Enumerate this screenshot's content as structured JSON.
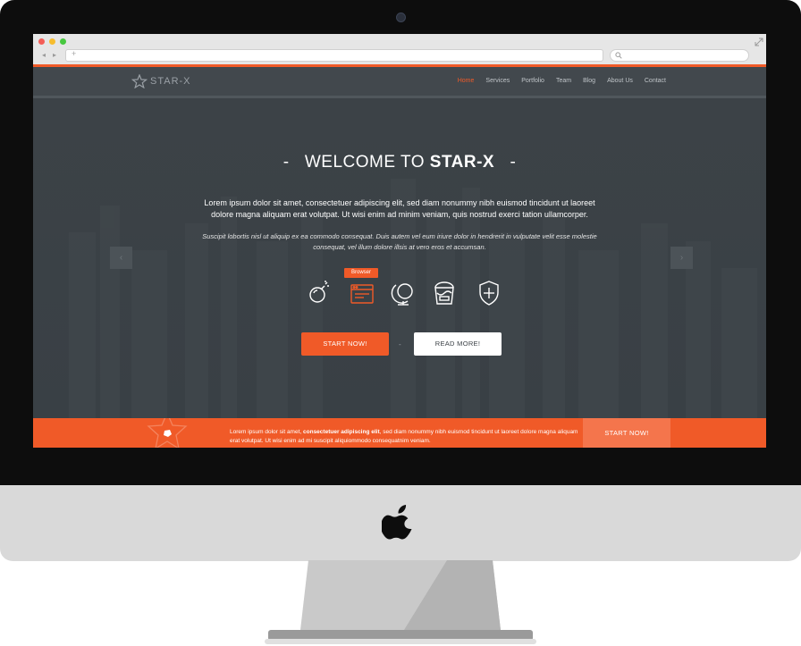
{
  "browser": {
    "url_text": "",
    "search_text": "",
    "back_glyph": "◂",
    "forward_glyph": "▸",
    "new_tab_glyph": "+"
  },
  "header": {
    "logo_text": "STAR-X",
    "nav": [
      "Home",
      "Services",
      "Portfolio",
      "Team",
      "Blog",
      "About Us",
      "Contact"
    ],
    "active": "Home"
  },
  "hero": {
    "title_prefix": "-   WELCOME TO ",
    "title_brand": "STAR-X",
    "title_suffix": "   -",
    "lead": "Lorem ipsum dolor sit amet, consectetuer adipiscing elit, sed diam nonummy nibh euismod tincidunt ut laoreet dolore magna aliquam erat volutpat. Ut wisi enim ad minim veniam, quis nostrud exerci tation ullamcorper.",
    "sub": "Suscipit lobortis nisl ut aliquip ex ea commodo consequat. Duis autem vel eum iriure dolor in hendrerit in vulputate velit esse molestie consequat, vel illum dolore illsis at vero eros et accumsan.",
    "tooltip": "Browser",
    "icons": [
      "bomb-icon",
      "browser-icon",
      "globe-icon",
      "paint-bucket-icon",
      "shield-plus-icon"
    ],
    "btn_primary": "START NOW!",
    "btn_secondary": "READ MORE!",
    "separator": "-",
    "prev_glyph": "‹",
    "next_glyph": "›"
  },
  "footer": {
    "text_start": "Lorem ipsum dolor sit amet, ",
    "text_bold": "consectetuer adipiscing elit",
    "text_end": ", sed diam nonummy nibh euismod tincidunt ut laoreet dolore magna aliquam erat volutpat. Ut wisi enim ad mi suscipit aliquiommodo consequatnim veniam.",
    "button": "START NOW!"
  },
  "colors": {
    "accent": "#f05a28",
    "dark": "#3b4146",
    "white": "#ffffff"
  }
}
